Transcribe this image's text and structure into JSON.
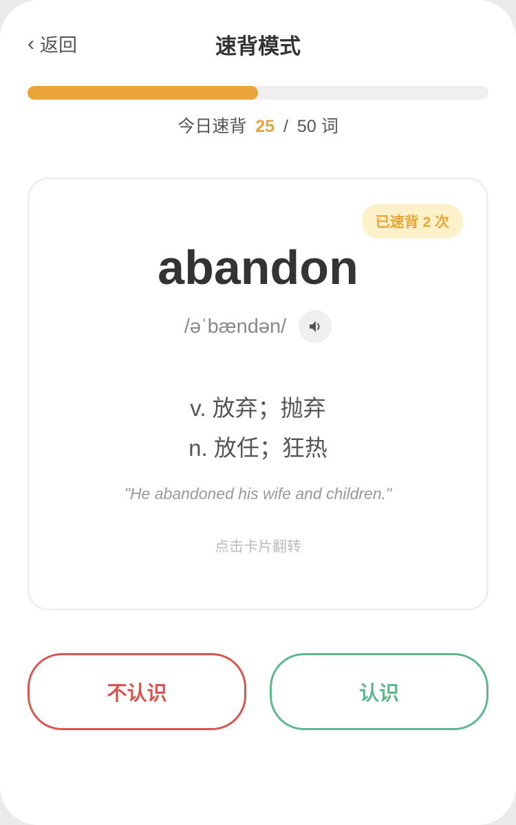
{
  "header": {
    "back_chevron": "‹",
    "back_label": "返回",
    "title": "速背模式"
  },
  "progress": {
    "prefix": "今日速背",
    "current": "25",
    "separator": "/",
    "total": "50",
    "unit": "词",
    "fraction": 0.5,
    "accent_color": "#e9a43a"
  },
  "card": {
    "badge": "已速背 2 次",
    "word": "abandon",
    "phonetic": "/əˈbændən/",
    "sound_icon": "speaker-icon",
    "definitions": [
      "v. 放弃；抛弃",
      "n. 放任；狂热"
    ],
    "example": "\"He abandoned his wife and children.\"",
    "hint": "点击卡片翻转"
  },
  "actions": {
    "unknown_label": "不认识",
    "known_label": "认识",
    "unknown_color": "#d9544f",
    "known_color": "#5cb88a"
  }
}
